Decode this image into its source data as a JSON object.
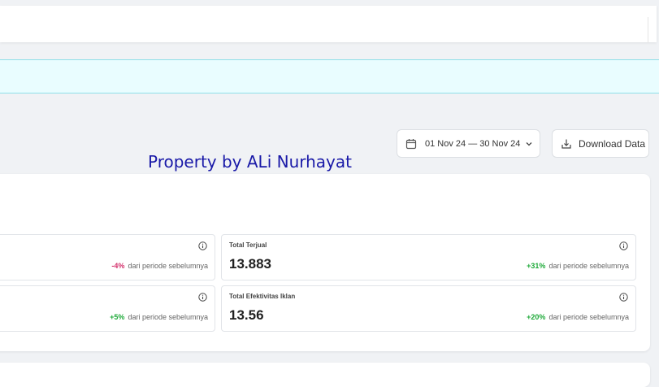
{
  "toolbar": {
    "date_range": "01 Nov 24 — 30 Nov 24",
    "download_label": "Download Data"
  },
  "watermark": "Property by ALi Nurhayat",
  "metrics": [
    {
      "label": "",
      "value": "",
      "delta": "-4%",
      "delta_text": "dari periode sebelumnya",
      "trend": "negative"
    },
    {
      "label": "Total Terjual",
      "value": "13.883",
      "delta": "+31%",
      "delta_text": "dari periode sebelumnya",
      "trend": "positive"
    },
    {
      "label": "",
      "value": "",
      "delta": "+5%",
      "delta_text": "dari periode sebelumnya",
      "trend": "positive"
    },
    {
      "label": "Total Efektivitas Iklan",
      "value": "13.56",
      "delta": "+20%",
      "delta_text": "dari periode sebelumnya",
      "trend": "positive"
    }
  ],
  "colors": {
    "negative": "#d32f6b",
    "positive": "#1faa3a",
    "banner_bg": "#e9fdff",
    "page_bg": "#f0f2f5"
  },
  "icons": {
    "date": "calendar-icon",
    "dropdown": "chevron-down-icon",
    "download": "download-icon",
    "info": "info-icon"
  }
}
